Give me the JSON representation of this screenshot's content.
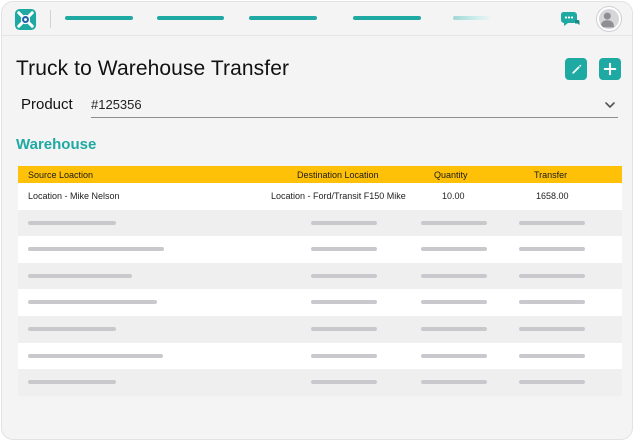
{
  "page": {
    "title": "Truck to Warehouse Transfer",
    "product_label": "Product",
    "product_value": "#125356",
    "section_title": "Warehouse"
  },
  "icons": {
    "logo": "app-logo-icon",
    "chat": "chat-icon",
    "avatar": "user-avatar",
    "edit": "pencil-icon",
    "add": "plus-icon",
    "dropdown": "chevron-down-icon"
  },
  "colors": {
    "accent": "#1fa9a3",
    "table_header": "#ffc107"
  },
  "table": {
    "headers": [
      "Source Loaction",
      "Destination Location",
      "Quantity",
      "Transfer"
    ],
    "rows": [
      [
        "Location - Mike Nelson",
        "Location - Ford/Transit F150 Mike",
        "10.00",
        "1658.00"
      ]
    ],
    "placeholder_rows": 7
  }
}
